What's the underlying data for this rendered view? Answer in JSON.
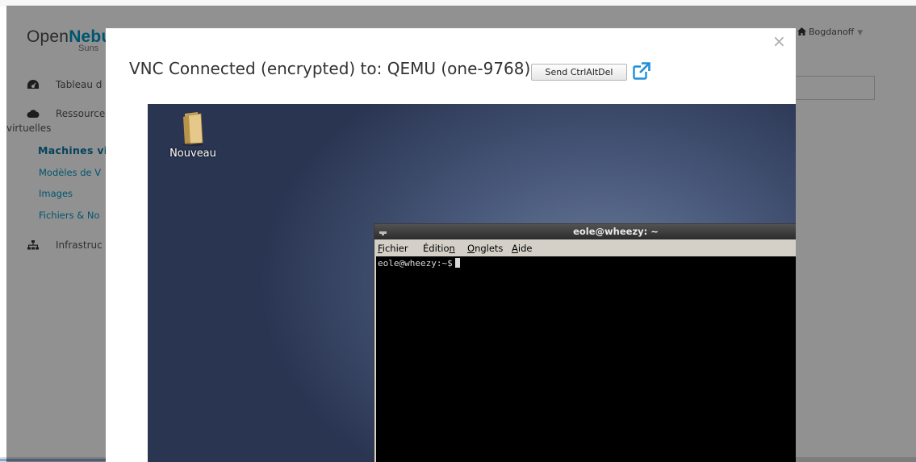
{
  "app": {
    "logo_open": "Open",
    "logo_brand": "Nebu",
    "logo_sub": "Suns",
    "user": "Bogdanoff",
    "nav": [
      {
        "label": "Tableau d",
        "icon": "dashboard-icon"
      },
      {
        "label": "Ressource",
        "label2": "virtuelles",
        "icon": "cloud-icon"
      },
      {
        "label": "Infrastruc",
        "icon": "sitemap-icon"
      }
    ],
    "subnav": [
      {
        "label": "Machines vi",
        "active": true
      },
      {
        "label": "Modèles de V"
      },
      {
        "label": "Images"
      },
      {
        "label": "Fichiers & No"
      }
    ]
  },
  "modal": {
    "title": "VNC Connected (encrypted) to: QEMU (one-9768)",
    "send_button": "Send CtrlAltDel",
    "close": "×"
  },
  "vnc": {
    "desktop_icon_label": "Nouveau",
    "terminal": {
      "title": "eole@wheezy: ~",
      "controls": "– ▫ ×",
      "menu": [
        "Fichier",
        "Édition",
        "Onglets",
        "Aide"
      ],
      "prompt": "eole@wheezy:~$"
    }
  },
  "colors": {
    "brand": "#0098c3",
    "overlay": "#000000",
    "terminal_bg": "#000000"
  }
}
